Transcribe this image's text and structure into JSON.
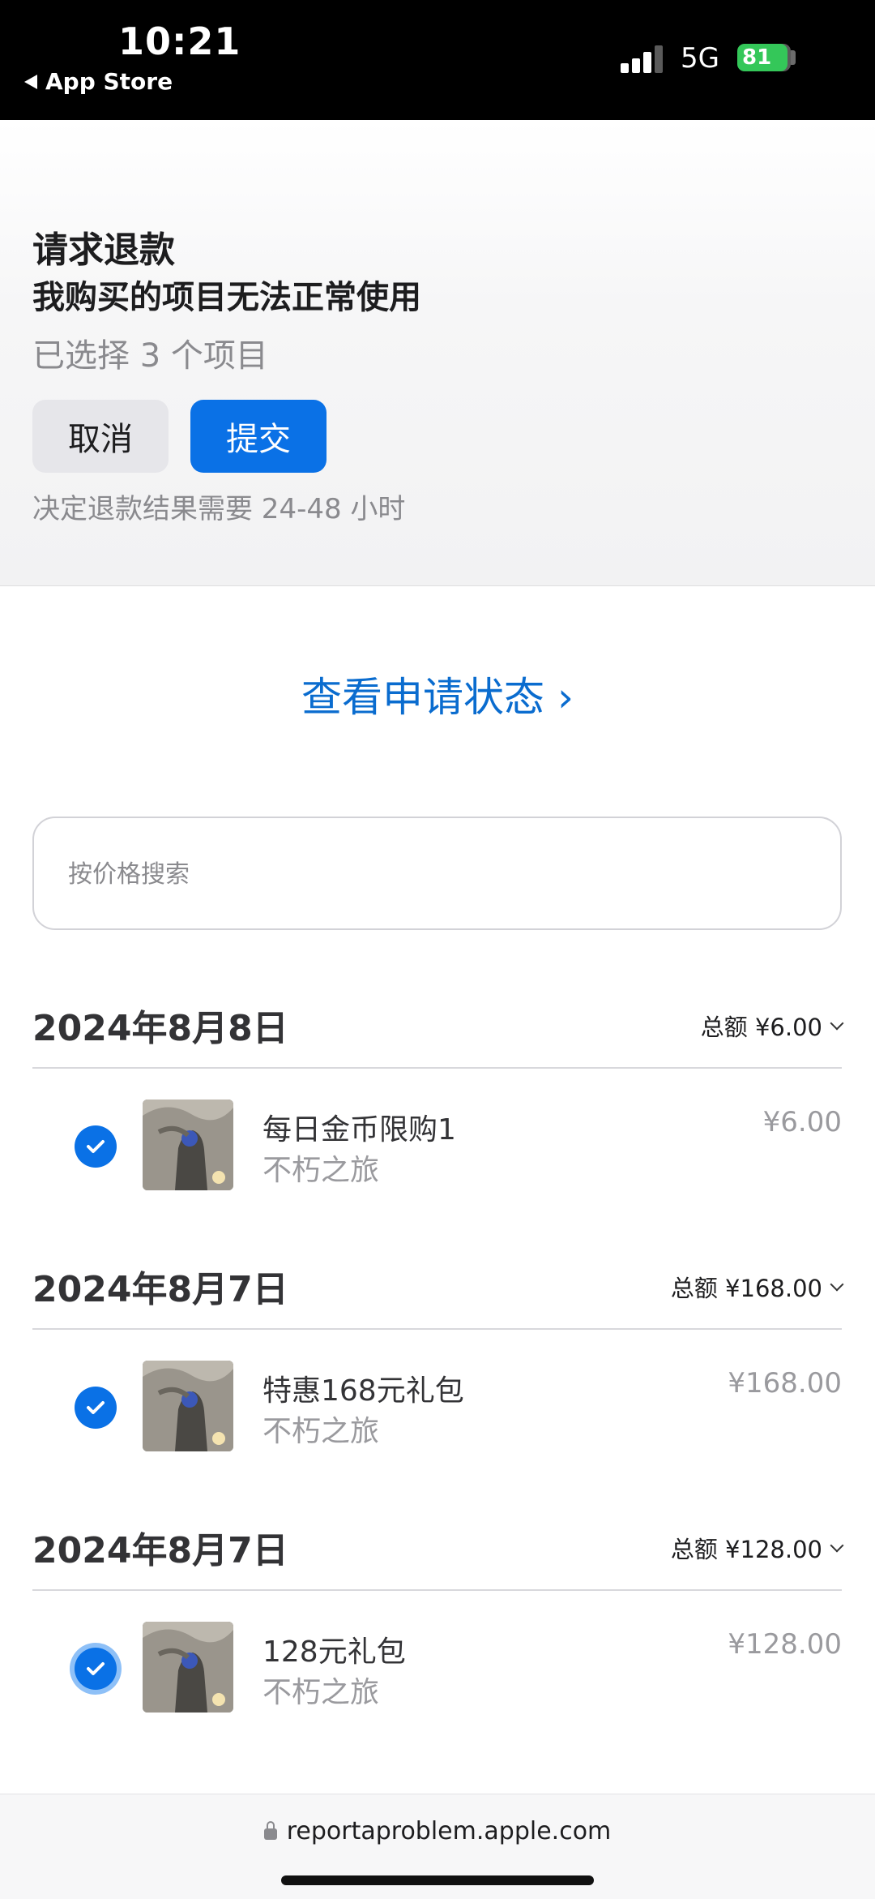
{
  "status_bar": {
    "time": "10:21",
    "back_label": "App Store",
    "network": "5G",
    "battery": "81"
  },
  "request": {
    "title": "请求退款",
    "reason": "我购买的项目无法正常使用",
    "selected": "已选择 3 个项目",
    "cancel_label": "取消",
    "submit_label": "提交",
    "note": "决定退款结果需要 24-48 小时"
  },
  "status_link": "查看申请状态 ›",
  "search": {
    "placeholder": "按价格搜索"
  },
  "groups": [
    {
      "date": "2024年8月8日",
      "total": "总额 ¥6.00",
      "item": {
        "name": "每日金币限购1",
        "app": "不朽之旅",
        "price": "¥6.00",
        "checked": true
      }
    },
    {
      "date": "2024年8月7日",
      "total": "总额 ¥168.00",
      "item": {
        "name": "特惠168元礼包",
        "app": "不朽之旅",
        "price": "¥168.00",
        "checked": true
      }
    },
    {
      "date": "2024年8月7日",
      "total": "总额 ¥128.00",
      "item": {
        "name": "128元礼包",
        "app": "不朽之旅",
        "price": "¥128.00",
        "checked": true
      }
    }
  ],
  "url_bar": {
    "url": "reportaproblem.apple.com"
  },
  "colors": {
    "accent": "#0a71e6",
    "link": "#0a6ccf",
    "battery": "#34c759"
  }
}
